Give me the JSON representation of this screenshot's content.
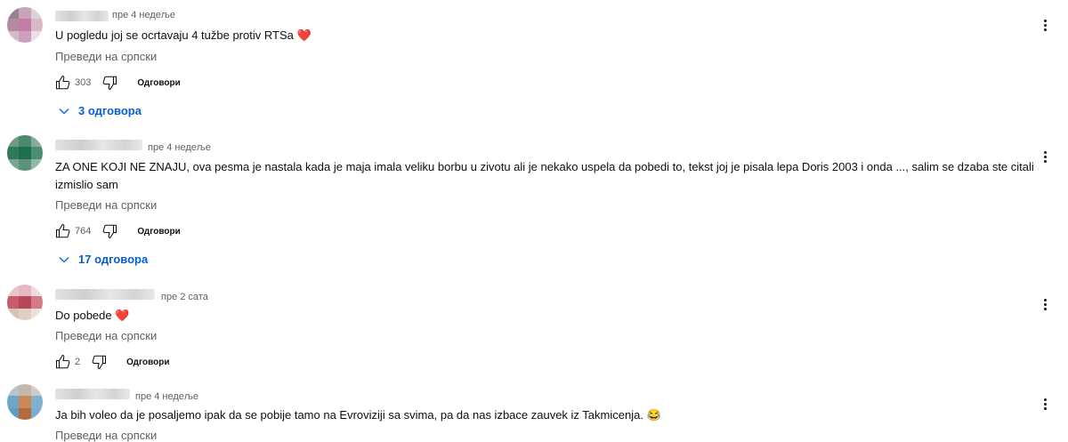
{
  "comments": [
    {
      "time": "пре 4 недеље",
      "text": "U pogledu joj se ocrtavaju 4 tužbe protiv RTSa",
      "heart": "❤️",
      "translate": "Преведи на српски",
      "likes": "303",
      "reply": "Одговори",
      "replies": "3 одговора"
    },
    {
      "time": "пре 4 недеље",
      "text": "ZA ONE KOJI NE ZNAJU, ova pesma je nastala kada je maja imala veliku borbu u zivotu ali je nekako uspela da pobedi to, tekst joj je pisala lepa Doris 2003 i onda ..., salim se dzaba ste citali izmislio sam",
      "translate": "Преведи на српски",
      "likes": "764",
      "reply": "Одговори",
      "replies": "17 одговора"
    },
    {
      "time": "пре 2 сата",
      "text": "Do pobede",
      "heart": "❤️",
      "translate": "Преведи на српски",
      "likes": "2",
      "reply": "Одговори"
    },
    {
      "time": "пре 4 недеље",
      "text": "Ja bih voleo da je posaljemo ipak da se pobije tamo na Evroviziji sa svima, pa da nas izbace zauvek iz Takmicenja.",
      "emoji": "😂",
      "translate": "Преведи на српски"
    }
  ],
  "icons": {
    "like": "thumbs-up-icon",
    "dislike": "thumbs-down-icon",
    "more": "more-vert-icon",
    "expand": "chevron-down-icon"
  },
  "colors": {
    "link": "#065fd4",
    "secondary": "#606060",
    "heart": "#e0245e"
  }
}
